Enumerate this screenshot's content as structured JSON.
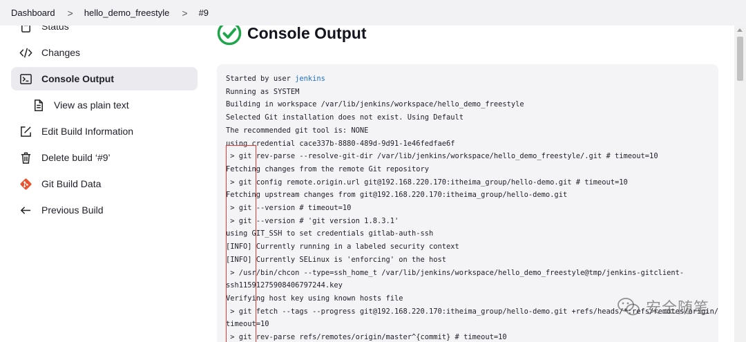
{
  "breadcrumb": {
    "items": [
      "Dashboard",
      "hello_demo_freestyle",
      "#9"
    ],
    "separator": ">"
  },
  "sidebar": {
    "items": [
      {
        "label": "Status",
        "icon": "document-icon"
      },
      {
        "label": "Changes",
        "icon": "code-icon"
      },
      {
        "label": "Console Output",
        "icon": "terminal-icon",
        "active": true
      },
      {
        "label": "View as plain text",
        "icon": "file-icon"
      },
      {
        "label": "Edit Build Information",
        "icon": "edit-icon"
      },
      {
        "label": "Delete build ‘#9’",
        "icon": "trash-icon"
      },
      {
        "label": "Git Build Data",
        "icon": "git-icon"
      },
      {
        "label": "Previous Build",
        "icon": "arrow-left-icon"
      }
    ]
  },
  "main": {
    "title": "Console Output",
    "console": {
      "started_prefix": "Started by user ",
      "user": "jenkins",
      "lines": [
        "Running as SYSTEM",
        "Building in workspace /var/lib/jenkins/workspace/hello_demo_freestyle",
        "Selected Git installation does not exist. Using Default",
        "The recommended git tool is: NONE",
        "using credential cace337b-8880-489d-9d91-1e46fedfae6f",
        " > git rev-parse --resolve-git-dir /var/lib/jenkins/workspace/hello_demo_freestyle/.git # timeout=10",
        "Fetching changes from the remote Git repository",
        " > git config remote.origin.url git@192.168.220.170:itheima_group/hello-demo.git # timeout=10",
        "Fetching upstream changes from git@192.168.220.170:itheima_group/hello-demo.git",
        " > git --version # timeout=10",
        " > git --version # 'git version 1.8.3.1'",
        "using GIT_SSH to set credentials gitlab-auth-ssh",
        "[INFO] Currently running in a labeled security context",
        "[INFO] Currently SELinux is 'enforcing' on the host",
        " > /usr/bin/chcon --type=ssh_home_t /var/lib/jenkins/workspace/hello_demo_freestyle@tmp/jenkins-gitclient-",
        "ssh11591275908406797244.key",
        "Verifying host key using known hosts file",
        " > git fetch --tags --progress git@192.168.220.170:itheima_group/hello-demo.git +refs/heads/*:refs/remotes/origin/* #",
        "timeout=10",
        " > git rev-parse refs/remotes/origin/master^{commit} # timeout=10"
      ]
    }
  },
  "watermark": {
    "text": "安全随笔"
  },
  "colors": {
    "success": "#1ea64b",
    "link": "#1a6fcf",
    "highlight_box": "#e53935",
    "console_bg": "#f4f4f6",
    "active_item_bg": "#ebebef"
  }
}
